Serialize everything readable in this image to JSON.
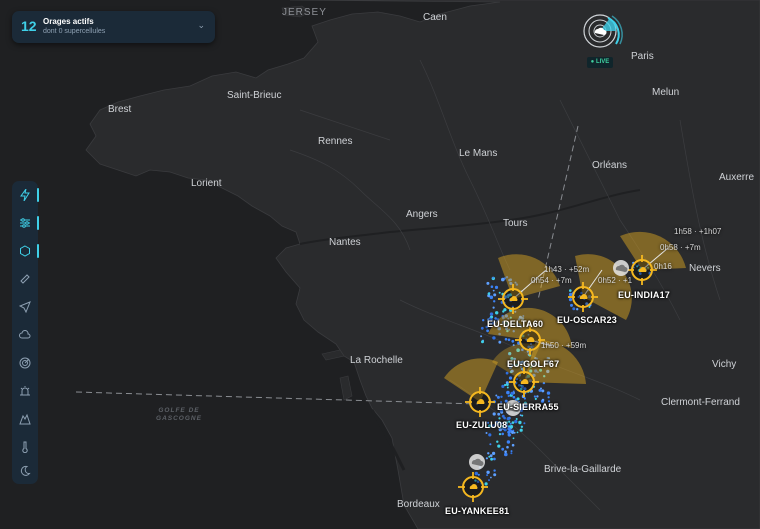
{
  "panel": {
    "count": "12",
    "title": "Orages actifs",
    "subtitle": "dont 0 supercellules",
    "chevron_icon": "chevron-down-icon"
  },
  "live": {
    "label": "LIVE"
  },
  "map": {
    "sea_label_line1": "GOLFE DE",
    "sea_label_line2": "GASCOGNE",
    "island": "JERSEY",
    "cities": [
      "Caen",
      "Paris",
      "Brest",
      "Saint-Brieuc",
      "Melun",
      "Rennes",
      "Le Mans",
      "Orléans",
      "Auxerre",
      "Lorient",
      "Angers",
      "Tours",
      "Nantes",
      "Nevers",
      "La Rochelle",
      "Vichy",
      "Clermont-Ferrand",
      "Brive-la-Gaillarde",
      "Bordeaux"
    ]
  },
  "storms": [
    {
      "id": "EU-INDIA17",
      "etas": [
        "1h58 · +1h07",
        "0h58 · +7m",
        "0h16"
      ]
    },
    {
      "id": "EU-OSCAR23",
      "etas": [
        "0h52 · +1"
      ]
    },
    {
      "id": "EU-DELTA60",
      "etas": [
        "1h43 · +52m",
        "0h54 · +7m"
      ]
    },
    {
      "id": "EU-GOLF67",
      "etas": [
        "1h50 · +59m"
      ]
    },
    {
      "id": "EU-SIERRA55",
      "etas": []
    },
    {
      "id": "EU-ZULU08",
      "etas": []
    },
    {
      "id": "EU-YANKEE81",
      "etas": []
    }
  ],
  "toolbar": {
    "items": [
      {
        "icon": "lightning-icon",
        "active": true
      },
      {
        "icon": "layers-sliders-icon",
        "active": true
      },
      {
        "icon": "hexagon-icon",
        "active": true
      },
      {
        "icon": "ruler-icon",
        "active": false
      },
      {
        "icon": "navigation-arrow-icon",
        "active": false
      },
      {
        "icon": "cloud-icon",
        "active": false
      },
      {
        "icon": "radar-icon",
        "active": false
      },
      {
        "icon": "alarm-icon",
        "active": false
      },
      {
        "icon": "mountain-icon",
        "active": false
      },
      {
        "icon": "thermometer-icon",
        "active": false
      },
      {
        "icon": "moon-icon",
        "active": false
      }
    ]
  },
  "colors": {
    "land": "#2a2b2d",
    "sea": "#1f2022",
    "accent": "#3fd0e8",
    "storm_ring": "#f5b820",
    "strike": "#3b82f6"
  }
}
